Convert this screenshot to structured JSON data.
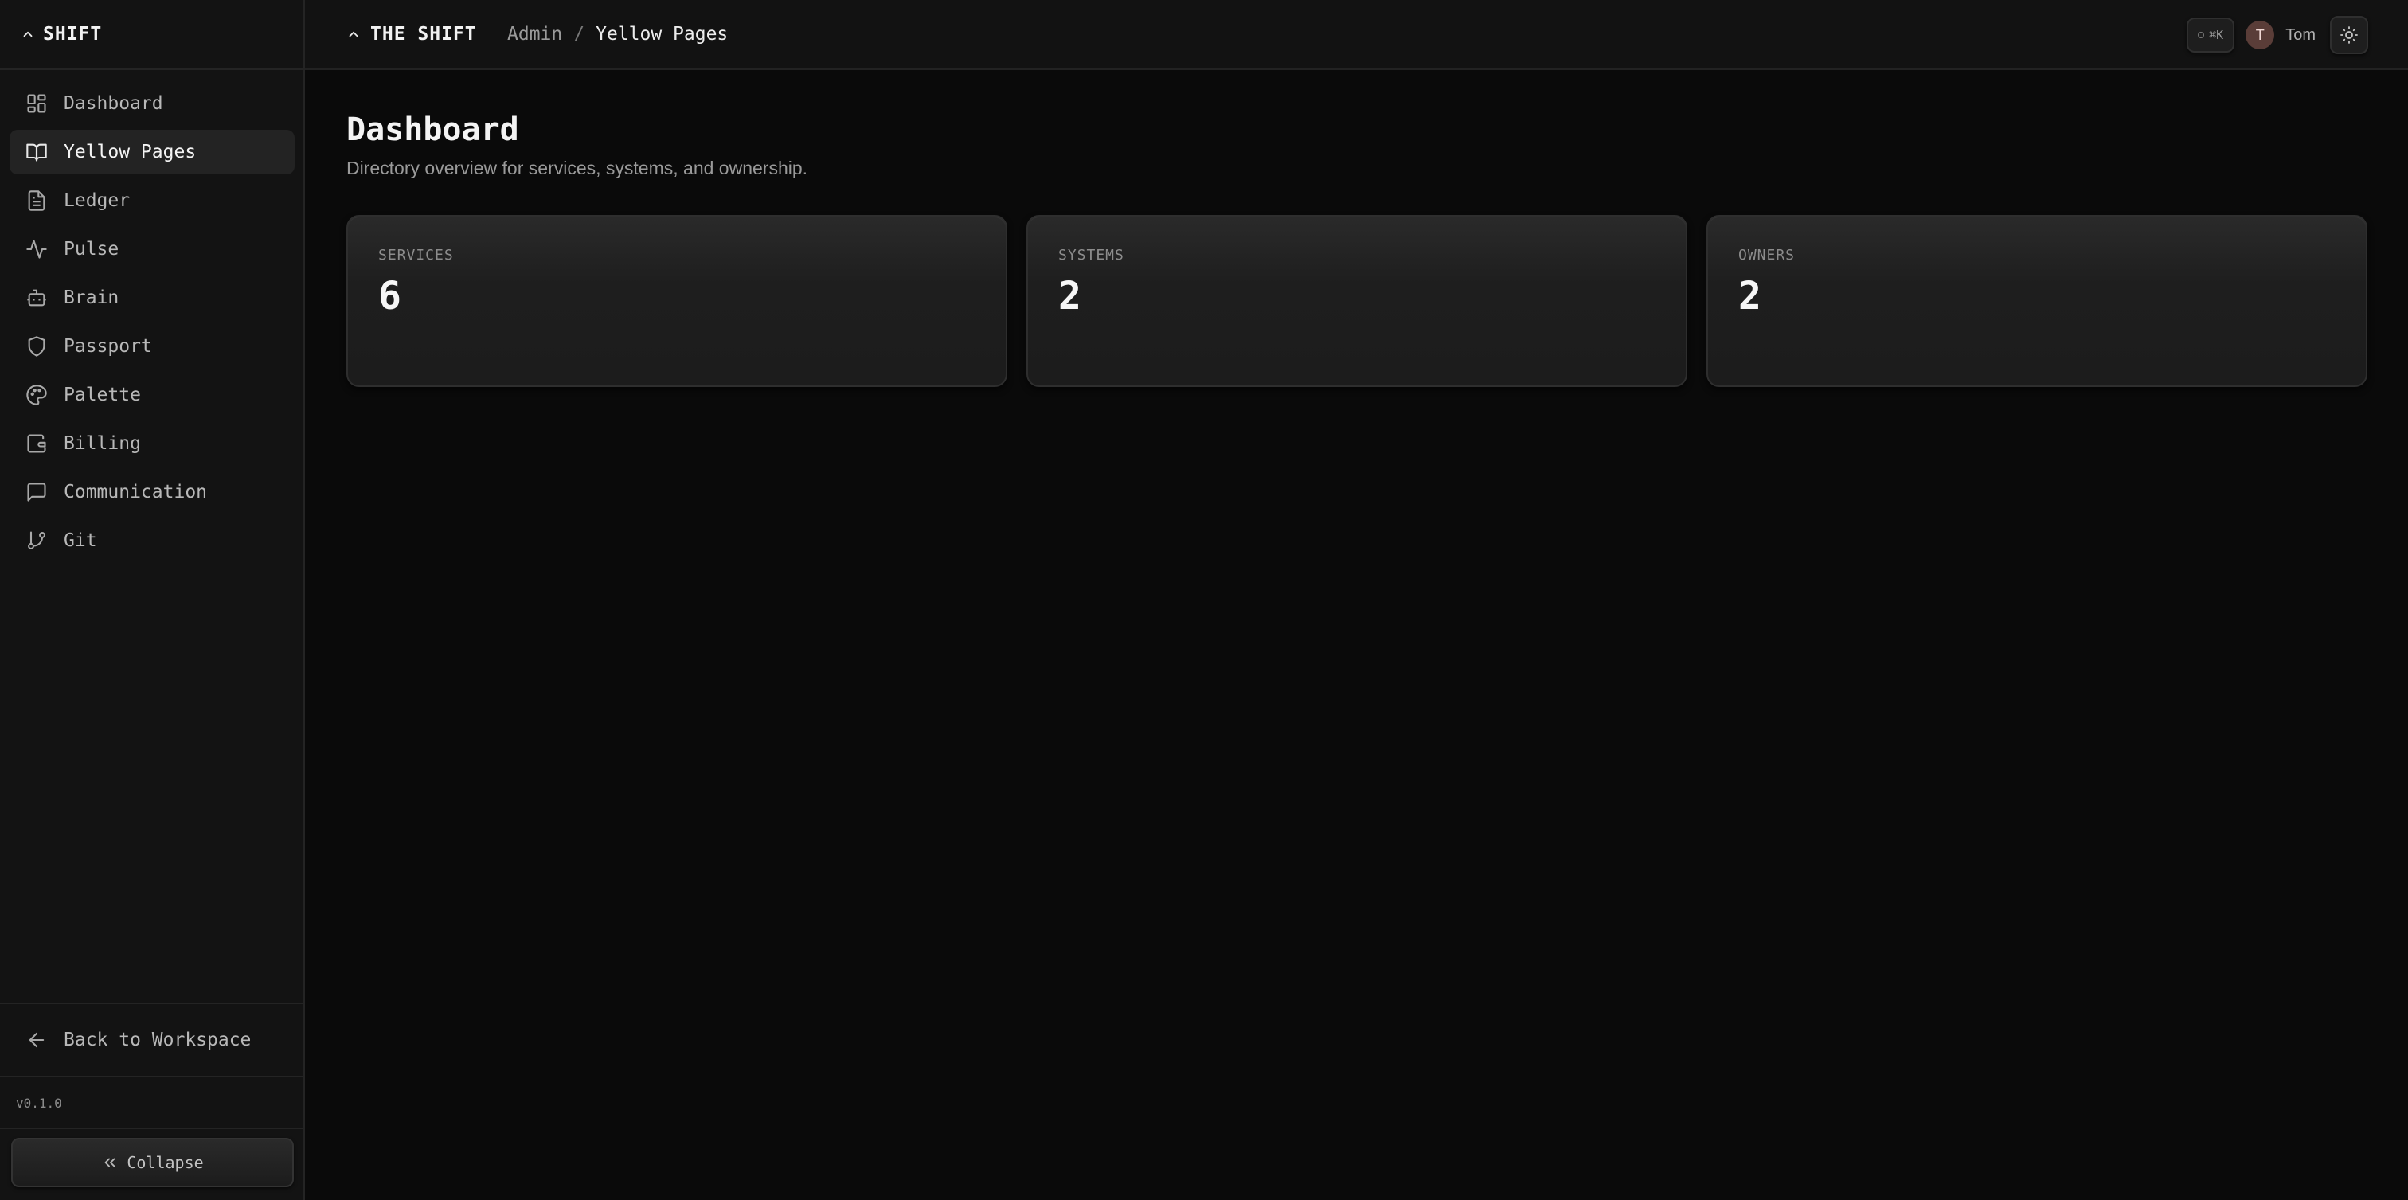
{
  "sidebar": {
    "brand": "SHIFT",
    "items": [
      {
        "label": "Dashboard",
        "icon": "dashboard-icon"
      },
      {
        "label": "Yellow Pages",
        "icon": "book-open-icon",
        "active": true
      },
      {
        "label": "Ledger",
        "icon": "file-text-icon"
      },
      {
        "label": "Pulse",
        "icon": "activity-icon"
      },
      {
        "label": "Brain",
        "icon": "bot-icon"
      },
      {
        "label": "Passport",
        "icon": "shield-icon"
      },
      {
        "label": "Palette",
        "icon": "palette-icon"
      },
      {
        "label": "Billing",
        "icon": "wallet-icon"
      },
      {
        "label": "Communication",
        "icon": "message-square-icon"
      },
      {
        "label": "Git",
        "icon": "git-branch-icon"
      }
    ],
    "back_label": "Back to Workspace",
    "version": "v0.1.0",
    "collapse_label": "Collapse"
  },
  "header": {
    "brand": "THE SHIFT",
    "breadcrumb": [
      "Admin",
      "/",
      "Yellow Pages"
    ],
    "shortcut": "⌘K",
    "avatar_initial": "T",
    "user_name": "Tom"
  },
  "main": {
    "title": "Dashboard",
    "subtitle": "Directory overview for services, systems, and ownership.",
    "stats": [
      {
        "label": "SERVICES",
        "value": "6"
      },
      {
        "label": "SYSTEMS",
        "value": "2"
      },
      {
        "label": "OWNERS",
        "value": "2"
      }
    ]
  },
  "colors": {
    "background": "#0a0a0a",
    "sidebar": "#131313",
    "active_item": "#232323",
    "avatar": "#5a3d38"
  }
}
